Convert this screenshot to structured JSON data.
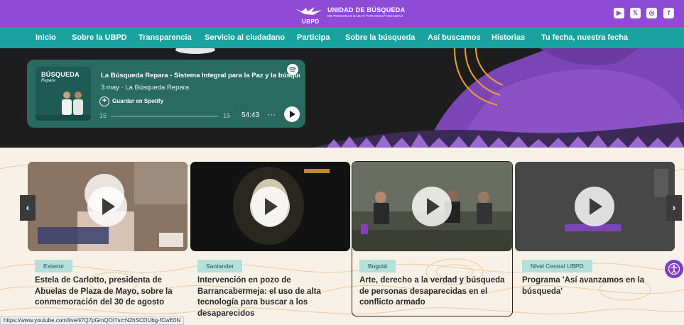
{
  "header": {
    "brand_short": "UBPD",
    "brand_title": "UNIDAD DE BÚSQUEDA",
    "brand_subtitle": "DE PERSONAS DADAS POR DESAPARECIDAS",
    "social_icons": [
      "youtube-icon",
      "x-icon",
      "instagram-icon",
      "facebook-icon"
    ],
    "social_glyphs": {
      "youtube": "▶",
      "x": "𝕏",
      "instagram": "◎",
      "facebook": "f"
    },
    "color": "#8f4ad6"
  },
  "nav": {
    "color": "#1aa39e",
    "items": [
      {
        "label": "Inicio"
      },
      {
        "label": "Sobre la UBPD"
      },
      {
        "label": "Transparencia"
      },
      {
        "label": "Servicio al ciudadano"
      },
      {
        "label": "Participa"
      },
      {
        "label": "Sobre la búsqueda"
      },
      {
        "label": "Así buscamos"
      },
      {
        "label": "Historias"
      },
      {
        "label": "Tu fecha, nuestra fecha"
      }
    ]
  },
  "spotify": {
    "cover_title": "BÚSQUEDA",
    "cover_subtitle": "Repara",
    "episode_title": "La Búsqueda Repara - Sistema Integral para la Paz y la búsque",
    "meta": "3 may · La Búsqueda Repara",
    "save_label": "Guardar en Spotify",
    "rewind_label": "15",
    "forward_label": "15",
    "time_remaining": "54:43",
    "more_label": "···",
    "color": "#2a6b61"
  },
  "carousel": {
    "prev_label": "‹",
    "next_label": "›",
    "cards": [
      {
        "tag": "Exterior",
        "title": "Estela de Carlotto, presidenta de Abuelas de Plaza de Mayo, sobre la conmemoración del 30 de agosto"
      },
      {
        "tag": "Santander",
        "title": "Intervención en pozo de Barrancabermeja: el uso de alta tecnología para buscar a los desaparecidos"
      },
      {
        "tag": "Bogotá",
        "title": "Arte, derecho a la verdad y búsqueda de personas desaparecidas en el conflicto armado"
      },
      {
        "tag": "Nivel Central UBPD",
        "title": "Programa 'Así avanzamos en la búsqueda'"
      }
    ]
  },
  "status_url": "https://www.youtube.com/live/li7Q7pGmQOI?si=N2hSCDUbg-fCwE0N",
  "accessibility_icon": "accessibility-icon"
}
